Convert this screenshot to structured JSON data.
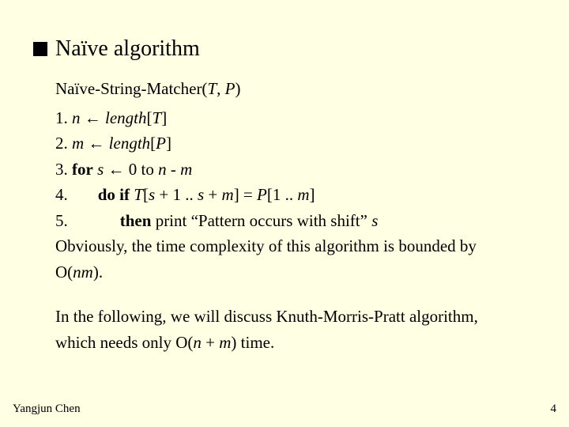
{
  "title": "Naïve algorithm",
  "proc": {
    "name_prefix": "Naïve-String-Matcher(",
    "arg1": "T",
    "sep": ", ",
    "arg2": "P",
    "name_suffix": ")"
  },
  "lines": {
    "l1_num": "1. ",
    "l1_n": "n",
    "l1_arrow": " ← ",
    "l1_len": "length",
    "l1_br": "[",
    "l1_T": "T",
    "l1_br2": "]",
    "l2_num": "2. ",
    "l2_m": "m",
    "l2_arrow": " ← ",
    "l2_len": "length",
    "l2_br": "[",
    "l2_P": "P",
    "l2_br2": "]",
    "l3_num": "3. ",
    "l3_for": "for",
    "l3_sp": " ",
    "l3_s": "s",
    "l3_arrow": " ← 0 to ",
    "l3_n": "n",
    "l3_minus": " - ",
    "l3_m": "m",
    "l4_num": "4.",
    "l4_doif": "do if ",
    "l4_T": "T",
    "l4_a": "[",
    "l4_s1": "s",
    "l4_b": " + 1 .. ",
    "l4_s2": "s",
    "l4_c": " + ",
    "l4_m": "m",
    "l4_d": "] = ",
    "l4_P": "P",
    "l4_e": "[1 .. ",
    "l4_m2": "m",
    "l4_f": "]",
    "l5_num": "5.",
    "l5_then": "then ",
    "l5_print": "print “Pattern occurs with shift” ",
    "l5_s": "s",
    "obv_a": "Obviously, the time complexity of this algorithm is bounded by",
    "obv_b1": "O(",
    "obv_b2": "nm",
    "obv_b3": ")."
  },
  "note": {
    "a": "In the following, we will discuss Knuth-Morris-Pratt algorithm,",
    "b1": "which needs only O(",
    "b2": "n",
    "b3": " + ",
    "b4": "m",
    "b5": ") time."
  },
  "footer": {
    "author": "Yangjun Chen",
    "page": "4"
  }
}
